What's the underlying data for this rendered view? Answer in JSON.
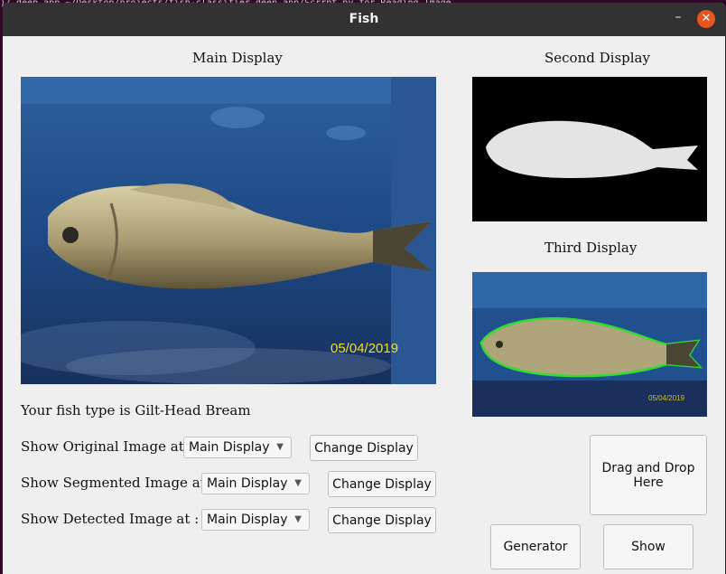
{
  "terminal_text": ")/ deep app  ~/Desktop/projects/fish-classifier  deep app/Scrrpt.py for Reading  Image",
  "window": {
    "title": "Fish",
    "minimize_glyph": "–",
    "close_glyph": "✕"
  },
  "displays": {
    "main_label": "Main Display",
    "second_label": "Second Display",
    "third_label": "Third Display",
    "main_photo_date": "05/04/2019"
  },
  "result_text": "Your fish type is Gilt-Head Bream",
  "rows": [
    {
      "label": "Show Original Image at :",
      "selected": "Main Display",
      "button": "Change Display"
    },
    {
      "label": "Show Segmented Image at :",
      "selected": "Main Display",
      "button": "Change Display"
    },
    {
      "label": "Show Detected Image at :",
      "selected": "Main Display",
      "button": "Change Display"
    }
  ],
  "buttons": {
    "drop": "Drag and Drop Here",
    "generator": "Generator",
    "show": "Show"
  },
  "colors": {
    "titlebar": "#323232",
    "close": "#e95420",
    "contour": "#33dd33",
    "date_stamp": "#f0e020"
  },
  "icons": {
    "arrow": "chevron-down-icon",
    "close": "close-icon",
    "minimize": "minimize-icon"
  }
}
